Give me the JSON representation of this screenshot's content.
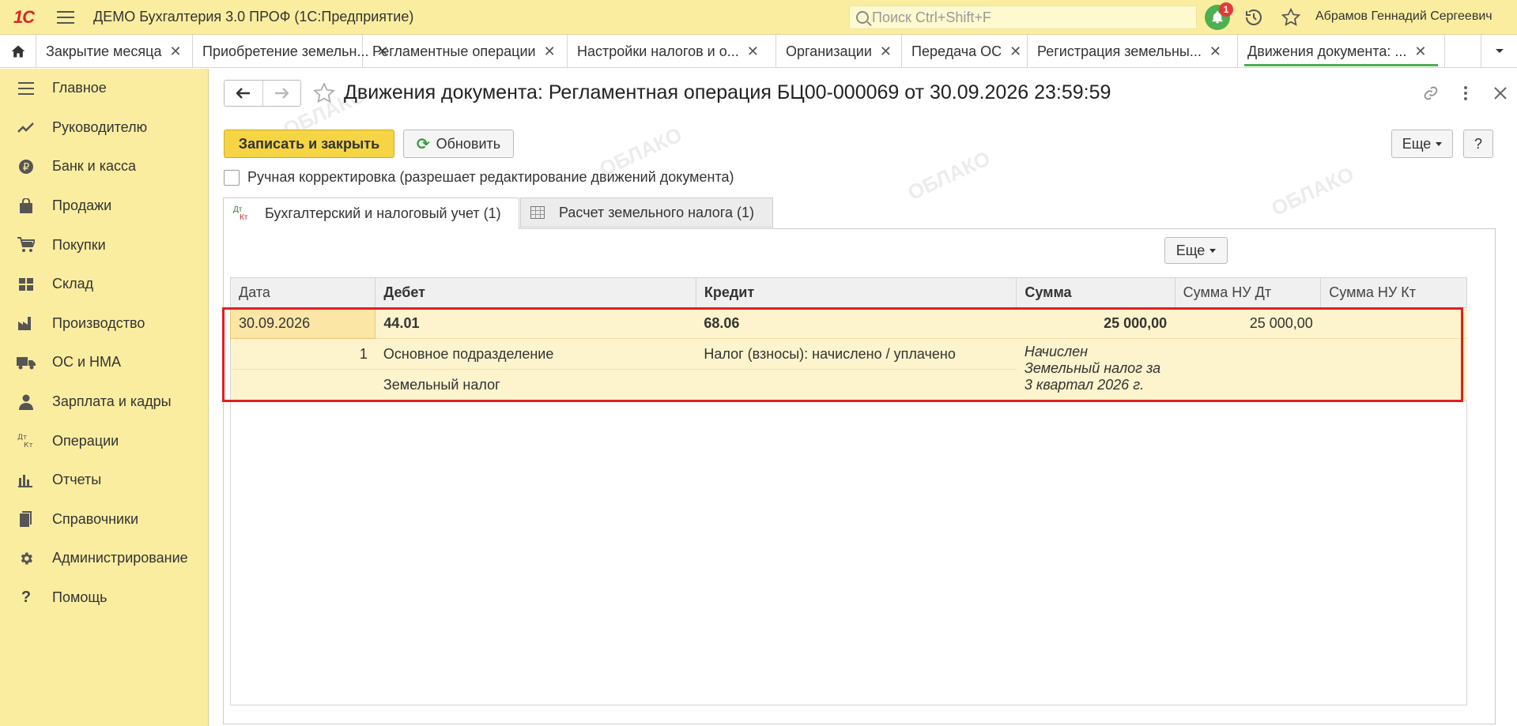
{
  "app": {
    "logo_text": "1С",
    "title": "ДЕМО Бухгалтерия 3.0 ПРОФ  (1С:Предприятие)",
    "search_placeholder": "Поиск Ctrl+Shift+F",
    "notifications_count": "1",
    "user_name": "Абрамов Геннадий Сергеевич"
  },
  "tabs": [
    {
      "label": "Закрытие месяца"
    },
    {
      "label": "Приобретение земельн..."
    },
    {
      "label": "Регламентные операции"
    },
    {
      "label": "Настройки налогов и о..."
    },
    {
      "label": "Организации"
    },
    {
      "label": "Передача ОС"
    },
    {
      "label": "Регистрация земельны..."
    },
    {
      "label": "Движения документа: ..."
    }
  ],
  "sidebar": {
    "items": [
      {
        "label": "Главное",
        "icon": "menu-icon"
      },
      {
        "label": "Руководителю",
        "icon": "trend-icon"
      },
      {
        "label": "Банк и касса",
        "icon": "ruble-icon"
      },
      {
        "label": "Продажи",
        "icon": "bag-icon"
      },
      {
        "label": "Покупки",
        "icon": "cart-icon"
      },
      {
        "label": "Склад",
        "icon": "warehouse-icon"
      },
      {
        "label": "Производство",
        "icon": "factory-icon"
      },
      {
        "label": "ОС и НМА",
        "icon": "truck-icon"
      },
      {
        "label": "Зарплата и кадры",
        "icon": "person-icon"
      },
      {
        "label": "Операции",
        "icon": "dtkt-icon"
      },
      {
        "label": "Отчеты",
        "icon": "bar-chart-icon"
      },
      {
        "label": "Справочники",
        "icon": "book-icon"
      },
      {
        "label": "Администрирование",
        "icon": "gear-icon"
      },
      {
        "label": "Помощь",
        "icon": "question-icon"
      }
    ]
  },
  "document": {
    "title": "Движения документа: Регламентная операция БЦ00-000069 от 30.09.2026 23:59:59",
    "save_close_label": "Записать и закрыть",
    "refresh_label": "Обновить",
    "more_label": "Еще",
    "help_label": "?",
    "manual_label": "Ручная корректировка (разрешает редактирование движений документа)",
    "tab_accounting": "Бухгалтерский и налоговый учет (1)",
    "tab_land_tax": "Расчет земельного налога (1)",
    "panel_more_label": "Еще"
  },
  "table": {
    "columns": [
      "Дата",
      "Дебет",
      "Кредит",
      "Сумма",
      "Сумма НУ Дт",
      "Сумма НУ Кт"
    ],
    "row": {
      "date": "30.09.2026",
      "line_no": "1",
      "debit_account": "44.01",
      "debit_sub1": "Основное подразделение",
      "debit_sub2": "Земельный налог",
      "credit_account": "68.06",
      "credit_sub1": "Налог (взносы): начислено / уплачено",
      "amount": "25 000,00",
      "content_1": "Начислен",
      "content_2": "Земельный налог за",
      "content_3": "3 квартал 2026 г.",
      "amount_nu_dt": "25 000,00",
      "amount_nu_kt": ""
    }
  },
  "colors": {
    "accent_yellow": "#fbeda0",
    "primary_button": "#f6d544",
    "row_highlight": "#fdf3cc",
    "selection_border": "#e02020",
    "active_tab_underline": "#4caf50"
  }
}
